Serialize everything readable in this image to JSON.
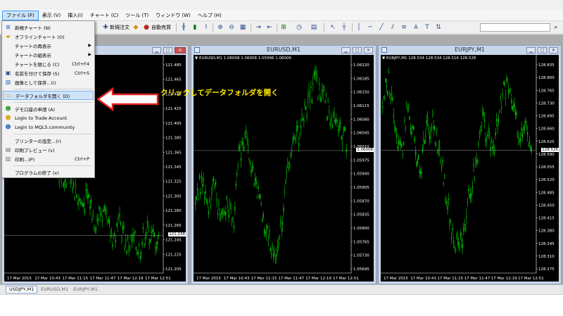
{
  "menubar": [
    "ファイル (F)",
    "表示 (V)",
    "挿入(I)",
    "チャート (C)",
    "ツール (T)",
    "ウィンドウ (W)",
    "ヘルプ (H)"
  ],
  "toolbar": {
    "new_order": "新規注文",
    "auto_trading": "自動売買"
  },
  "file_menu": [
    {
      "label": "新規チャート (N)",
      "shortcut": "",
      "icon": "new-chart-icon",
      "submenu": false
    },
    {
      "label": "オフラインチャート (O)",
      "shortcut": "",
      "icon": "offline-chart-icon",
      "submenu": false
    },
    {
      "label": "チャートの再表示",
      "shortcut": "",
      "icon": "",
      "submenu": true
    },
    {
      "label": "チャートの組表示",
      "shortcut": "",
      "icon": "",
      "submenu": true
    },
    {
      "label": "チャートを閉じる (C)",
      "shortcut": "Ctrl+F4",
      "icon": "",
      "submenu": false
    },
    {
      "label": "名前を付けて保存 (S)",
      "shortcut": "Ctrl+S",
      "icon": "save-icon",
      "submenu": false
    },
    {
      "label": "画像として保存...(i)",
      "shortcut": "",
      "icon": "image-icon",
      "submenu": false
    },
    {
      "label": "データフォルダを開く (D)",
      "shortcut": "",
      "icon": "folder-icon",
      "submenu": false
    },
    {
      "label": "デモ口座の申請 (A)",
      "shortcut": "",
      "icon": "demo-account-icon",
      "submenu": false
    },
    {
      "label": "Login to Trade Account",
      "shortcut": "",
      "icon": "login-icon",
      "submenu": false
    },
    {
      "label": "Login to MQL5.community",
      "shortcut": "",
      "icon": "mql5-icon",
      "submenu": false
    },
    {
      "label": "プリンターの設定...(r)",
      "shortcut": "",
      "icon": "",
      "submenu": false
    },
    {
      "label": "印刷プレビュー (v)",
      "shortcut": "",
      "icon": "print-preview-icon",
      "submenu": false
    },
    {
      "label": "印刷...(P)",
      "shortcut": "Ctrl+P",
      "icon": "print-icon",
      "submenu": false
    },
    {
      "label": "プログラムの終了 (x)",
      "shortcut": "",
      "icon": "",
      "submenu": false
    }
  ],
  "annotation": "クリックしてデータフォルダを開く",
  "charts": [
    {
      "title": "",
      "symbol_label": "",
      "current_price": "121.238",
      "price_labels": [
        "121.485",
        "121.465",
        "121.445",
        "121.425",
        "121.405",
        "121.385",
        "121.365",
        "121.345",
        "121.325",
        "121.305",
        "121.285",
        "121.265",
        "121.245",
        "121.225",
        "121.205"
      ],
      "time_labels": [
        "17 Mar 2015",
        "17 Mar 10:43",
        "17 Mar 11:15",
        "17 Mar 11:47",
        "17 Mar 12:19",
        "17 Mar 12:51"
      ]
    },
    {
      "title": "EURUSD,M1",
      "symbol_label": "▼ EURUSD,M1  1.06008 1.06008 1.05996 1.06006",
      "current_price": "1.06006",
      "price_labels": [
        "1.06220",
        "1.06185",
        "1.06150",
        "1.06115",
        "1.06080",
        "1.06045",
        "1.06010",
        "1.05975",
        "1.05940",
        "1.05905",
        "1.05870",
        "1.05835",
        "1.05800",
        "1.05765",
        "1.05730",
        "1.05695"
      ],
      "time_labels": [
        "17 Mar 2015",
        "17 Mar 10:43",
        "17 Mar 11:15",
        "17 Mar 11:47",
        "17 Mar 12:19",
        "17 Mar 12:51"
      ]
    },
    {
      "title": "EURJPY,M1",
      "symbol_label": "▼ EURJPY,M1  128.534 128.534 128.516 128.526",
      "current_price": "128.526",
      "price_labels": [
        "128.835",
        "128.800",
        "128.765",
        "128.730",
        "128.695",
        "128.660",
        "128.625",
        "128.590",
        "128.555",
        "128.520",
        "128.485",
        "128.450",
        "128.415",
        "128.380",
        "128.345",
        "128.310",
        "128.275"
      ],
      "time_labels": [
        "17 Mar 2015",
        "17 Mar 10:43",
        "17 Mar 11:15",
        "17 Mar 11:47",
        "17 Mar 12:19",
        "17 Mar 12:51"
      ]
    }
  ],
  "tabs": [
    "USDJPY,M1",
    "EURUSD,M1",
    "EURJPY,M1"
  ],
  "colors": {
    "candle": "#00b000",
    "chart_bg": "#000000",
    "annotation": "#ffea00",
    "arrow": "#e02020"
  }
}
